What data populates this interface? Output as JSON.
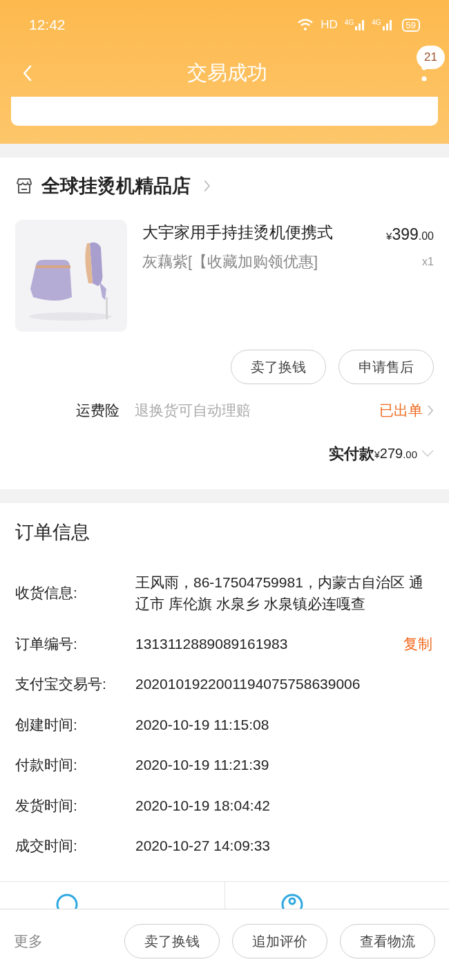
{
  "status_bar": {
    "time": "12:42",
    "network": "HD",
    "signals": [
      "4G",
      "4G"
    ],
    "battery": "59"
  },
  "nav": {
    "title": "交易成功",
    "badge": "21"
  },
  "shop": {
    "name": "全球挂烫机精品店",
    "product": {
      "title": "大宇家用手持挂烫机便携式",
      "variant": "灰藕紫[【收藏加购领优惠]",
      "currency": "¥",
      "price": "399",
      "price_decimal": ".00",
      "quantity": "x1"
    },
    "buttons": [
      "卖了换钱",
      "申请售后"
    ],
    "insurance": {
      "label": "运费险",
      "description": "退换货可自动理赔",
      "status": "已出单"
    },
    "total": {
      "label": "实付款",
      "currency": "¥",
      "amount": "279",
      "decimal": ".00"
    }
  },
  "order_info": {
    "title": "订单信息",
    "fields": [
      {
        "label": "收货信息:",
        "value": "王风雨，86-17504759981，内蒙古自治区 通辽市 库伦旗 水泉乡 水泉镇必连嘎查"
      },
      {
        "label": "订单编号:",
        "value": "1313112889089161983",
        "action": "复制"
      },
      {
        "label": "支付宝交易号:",
        "value": "2020101922001194075758639006"
      },
      {
        "label": "创建时间:",
        "value": "2020-10-19 11:15:08"
      },
      {
        "label": "付款时间:",
        "value": "2020-10-19 11:21:39"
      },
      {
        "label": "发货时间:",
        "value": "2020-10-19 18:04:42"
      },
      {
        "label": "成交时间:",
        "value": "2020-10-27 14:09:33"
      }
    ]
  },
  "bottom_bar": {
    "more": "更多",
    "buttons": [
      "卖了换钱",
      "追加评价",
      "查看物流"
    ]
  }
}
